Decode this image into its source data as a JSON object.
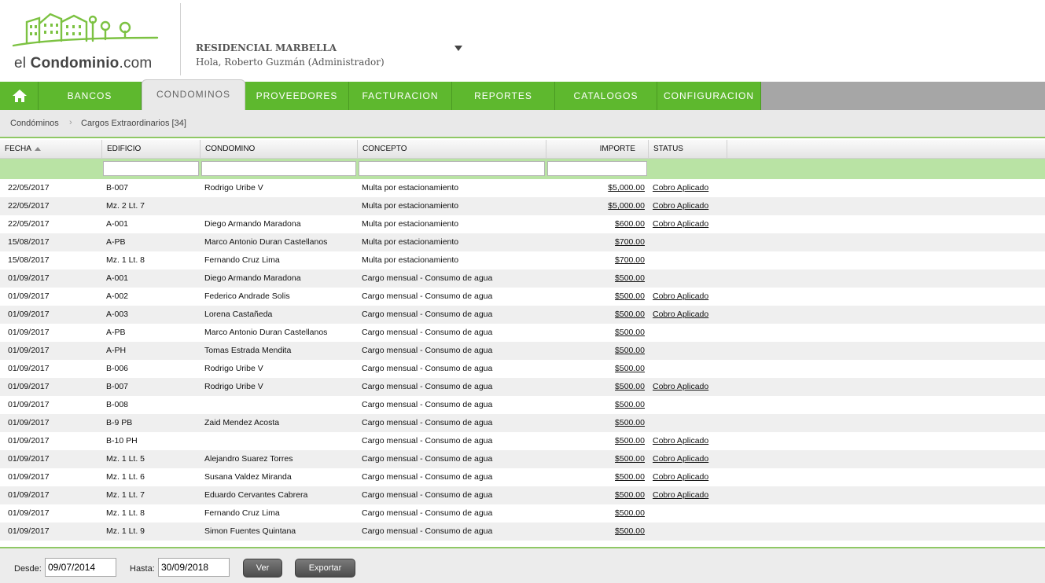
{
  "header": {
    "logo_prefix": "el ",
    "logo_brand": "Condominio",
    "logo_suffix": ".com",
    "condo_name": "RESIDENCIAL MARBELLA",
    "greeting": "Hola, Roberto Guzmán (Administrador)"
  },
  "nav": {
    "home_icon": "home-icon",
    "items": [
      "BANCOS",
      "CONDOMINOS",
      "PROVEEDORES",
      "FACTURACION",
      "REPORTES",
      "CATALOGOS",
      "CONFIGURACION"
    ],
    "active": "CONDOMINOS"
  },
  "breadcrumb": {
    "root": "Condóminos",
    "current": "Cargos Extraordinarios [34]"
  },
  "grid": {
    "columns": [
      "FECHA",
      "EDIFICIO",
      "CONDOMINO",
      "CONCEPTO",
      "IMPORTE",
      "STATUS"
    ],
    "rows": [
      [
        "22/05/2017",
        "B-007",
        "Rodrigo Uribe V",
        "Multa por estacionamiento",
        "$5,000.00",
        "Cobro Aplicado"
      ],
      [
        "22/05/2017",
        "Mz. 2 Lt. 7",
        "",
        "Multa por estacionamiento",
        "$5,000.00",
        "Cobro Aplicado"
      ],
      [
        "22/05/2017",
        "A-001",
        "Diego Armando Maradona",
        "Multa por estacionamiento",
        "$600.00",
        "Cobro Aplicado"
      ],
      [
        "15/08/2017",
        "A-PB",
        "Marco Antonio Duran Castellanos",
        "Multa por estacionamiento",
        "$700.00",
        ""
      ],
      [
        "15/08/2017",
        "Mz. 1 Lt. 8",
        "Fernando Cruz Lima",
        "Multa por estacionamiento",
        "$700.00",
        ""
      ],
      [
        "01/09/2017",
        "A-001",
        "Diego Armando Maradona",
        "Cargo mensual - Consumo de agua",
        "$500.00",
        ""
      ],
      [
        "01/09/2017",
        "A-002",
        "Federico Andrade Solis",
        "Cargo mensual - Consumo de agua",
        "$500.00",
        "Cobro Aplicado"
      ],
      [
        "01/09/2017",
        "A-003",
        "Lorena Castañeda",
        "Cargo mensual - Consumo de agua",
        "$500.00",
        "Cobro Aplicado"
      ],
      [
        "01/09/2017",
        "A-PB",
        "Marco Antonio Duran Castellanos",
        "Cargo mensual - Consumo de agua",
        "$500.00",
        ""
      ],
      [
        "01/09/2017",
        "A-PH",
        "Tomas Estrada Mendita",
        "Cargo mensual - Consumo de agua",
        "$500.00",
        ""
      ],
      [
        "01/09/2017",
        "B-006",
        "Rodrigo Uribe V",
        "Cargo mensual - Consumo de agua",
        "$500.00",
        ""
      ],
      [
        "01/09/2017",
        "B-007",
        "Rodrigo Uribe V",
        "Cargo mensual - Consumo de agua",
        "$500.00",
        "Cobro Aplicado"
      ],
      [
        "01/09/2017",
        "B-008",
        "",
        "Cargo mensual - Consumo de agua",
        "$500.00",
        ""
      ],
      [
        "01/09/2017",
        "B-9 PB",
        "Zaid Mendez Acosta",
        "Cargo mensual - Consumo de agua",
        "$500.00",
        ""
      ],
      [
        "01/09/2017",
        "B-10 PH",
        "",
        "Cargo mensual - Consumo de agua",
        "$500.00",
        "Cobro Aplicado"
      ],
      [
        "01/09/2017",
        "Mz. 1 Lt. 5",
        "Alejandro Suarez Torres",
        "Cargo mensual - Consumo de agua",
        "$500.00",
        "Cobro Aplicado"
      ],
      [
        "01/09/2017",
        "Mz. 1 Lt. 6",
        "Susana Valdez Miranda",
        "Cargo mensual - Consumo de agua",
        "$500.00",
        "Cobro Aplicado"
      ],
      [
        "01/09/2017",
        "Mz. 1 Lt. 7",
        "Eduardo Cervantes Cabrera",
        "Cargo mensual - Consumo de agua",
        "$500.00",
        "Cobro Aplicado"
      ],
      [
        "01/09/2017",
        "Mz. 1 Lt. 8",
        "Fernando Cruz Lima",
        "Cargo mensual - Consumo de agua",
        "$500.00",
        ""
      ],
      [
        "01/09/2017",
        "Mz. 1 Lt. 9",
        "Simon Fuentes Quintana",
        "Cargo mensual - Consumo de agua",
        "$500.00",
        ""
      ]
    ]
  },
  "footer": {
    "desde_label": "Desde:",
    "desde_value": "09/07/2014",
    "hasta_label": "Hasta:",
    "hasta_value": "30/09/2018",
    "ver_label": "Ver",
    "exportar_label": "Exportar"
  },
  "colors": {
    "brand_green": "#5eb82e",
    "filter_row": "#b9e3a4",
    "accent_line": "#8fc865"
  }
}
